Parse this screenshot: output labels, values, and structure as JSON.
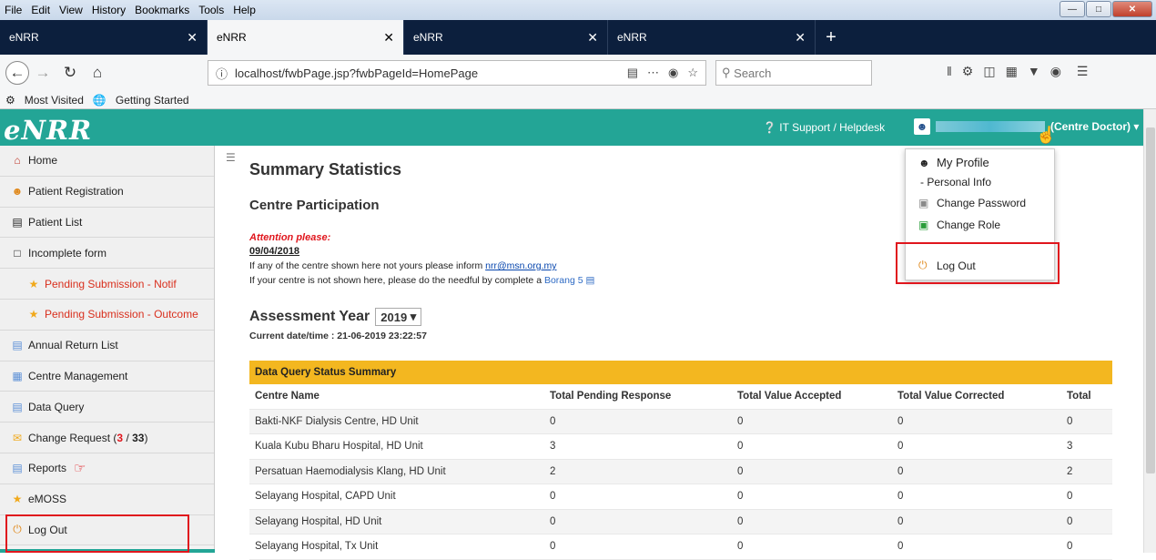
{
  "browser": {
    "menu": [
      "File",
      "Edit",
      "View",
      "History",
      "Bookmarks",
      "Tools",
      "Help"
    ],
    "tabs": [
      {
        "label": "eNRR"
      },
      {
        "label": "eNRR"
      },
      {
        "label": "eNRR"
      },
      {
        "label": "eNRR"
      }
    ],
    "url": "localhost/fwbPage.jsp?fwbPageId=HomePage",
    "search_placeholder": "Search",
    "bookmarks": [
      "Most Visited",
      "Getting Started"
    ]
  },
  "app": {
    "logo": "eNRR",
    "help_label": "IT Support / Helpdesk",
    "role": "(Centre Doctor)"
  },
  "sidebar": {
    "items": [
      {
        "label": "Home",
        "icon": "home-icon"
      },
      {
        "label": "Patient Registration",
        "icon": "users-icon"
      },
      {
        "label": "Patient List",
        "icon": "list-icon"
      },
      {
        "label": "Incomplete form",
        "icon": "form-icon"
      },
      {
        "label": "Pending Submission - Notif",
        "icon": "star-icon"
      },
      {
        "label": "Pending Submission - Outcome",
        "icon": "star-icon"
      },
      {
        "label": "Annual Return List",
        "icon": "document-icon"
      },
      {
        "label": "Centre Management",
        "icon": "computer-icon"
      },
      {
        "label": "Data Query",
        "icon": "query-icon"
      },
      {
        "label": "Change Request",
        "icon": "mail-icon",
        "count_new": "3",
        "count_total": "33"
      },
      {
        "label": "Reports",
        "icon": "chart-icon"
      },
      {
        "label": "eMOSS",
        "icon": "star-icon"
      },
      {
        "label": "Log Out",
        "icon": "power-icon"
      }
    ]
  },
  "main": {
    "title": "Summary Statistics",
    "subtitle": "Centre Participation",
    "attention": "Attention please:",
    "date": "09/04/2018",
    "line1_pre": "If any of the centre shown here not yours please inform ",
    "line1_email": "nrr@msn.org.my",
    "line2_pre": "If your centre is not shown here, please do the needful by complete a ",
    "line2_link": "Borang 5",
    "assessment_label": "Assessment Year",
    "assessment_year": "2019",
    "current_dt": "Current date/time : 21-06-2019 23:22:57"
  },
  "table": {
    "title": "Data Query Status Summary",
    "headers": [
      "Centre Name",
      "Total Pending Response",
      "Total Value Accepted",
      "Total Value Corrected",
      "Total"
    ],
    "rows": [
      [
        "Bakti-NKF Dialysis Centre, HD Unit",
        "0",
        "0",
        "0",
        "0"
      ],
      [
        "Kuala Kubu Bharu Hospital, HD Unit",
        "3",
        "0",
        "0",
        "3"
      ],
      [
        "Persatuan Haemodialysis Klang, HD Unit",
        "2",
        "0",
        "0",
        "2"
      ],
      [
        "Selayang Hospital, CAPD Unit",
        "0",
        "0",
        "0",
        "0"
      ],
      [
        "Selayang Hospital, HD Unit",
        "0",
        "0",
        "0",
        "0"
      ],
      [
        "Selayang Hospital, Tx Unit",
        "0",
        "0",
        "0",
        "0"
      ]
    ]
  },
  "dropdown": {
    "my_profile": "My Profile",
    "personal_info": "- Personal Info",
    "change_password": "Change Password",
    "change_role": "Change Role",
    "log_out": "Log Out"
  },
  "colors": {
    "header": "#23a596",
    "table_head": "#f3b720",
    "highlight": "#e0161d"
  }
}
